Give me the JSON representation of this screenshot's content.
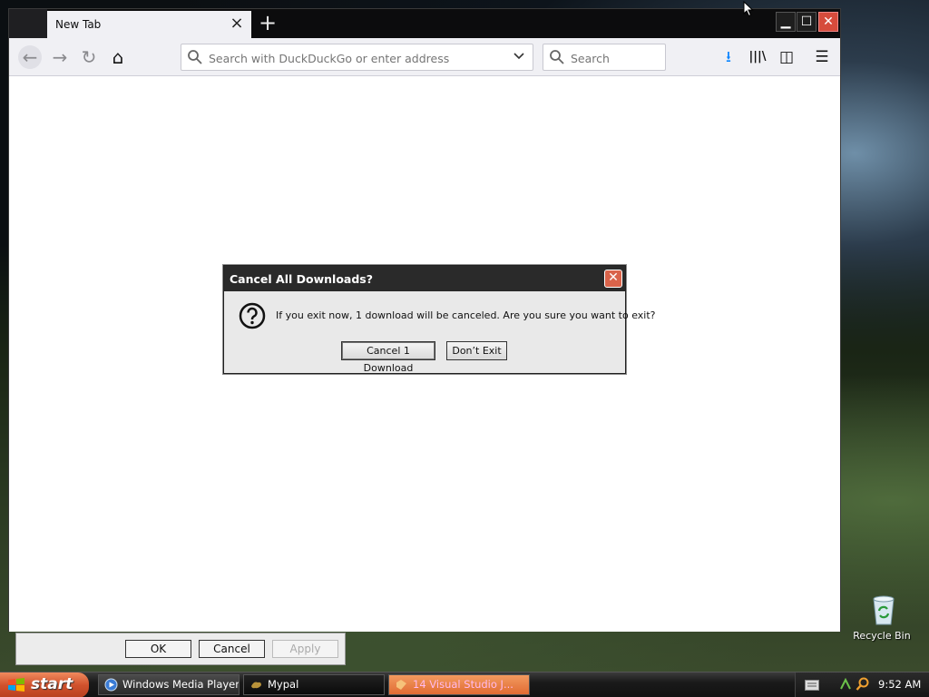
{
  "browser": {
    "tab_title": "New Tab",
    "tab_close_glyph": "×",
    "new_tab_glyph": "+",
    "window_min": "▁",
    "window_max": "☐",
    "window_close": "✕",
    "url_placeholder": "Search with DuckDuckGo or enter address",
    "search_placeholder": "Search",
    "nav": {
      "back": "←",
      "forward": "→",
      "reload": "↻",
      "home": "⌂"
    },
    "toolbar": {
      "download_glyph": "⭳",
      "library_glyph": "|||\\",
      "sidebar_glyph": "◫",
      "menu_glyph": "☰"
    },
    "download_color": "#0a84ff"
  },
  "dialog": {
    "title": "Cancel All Downloads?",
    "close_glyph": "✕",
    "message": "If you exit now, 1 download will be canceled. Are you sure you want to exit?",
    "cancel_button": "Cancel 1 Download",
    "dont_exit_button": "Don’t Exit"
  },
  "background_dialog": {
    "ok": "OK",
    "cancel": "Cancel",
    "apply": "Apply"
  },
  "desktop": {
    "recycle_bin": "Recycle Bin"
  },
  "taskbar": {
    "start": "start",
    "tasks": [
      {
        "label": "Windows Media Player"
      },
      {
        "label": "Mypal"
      },
      {
        "label": "14 Visual Studio J..."
      }
    ],
    "clock": "9:52 AM"
  }
}
